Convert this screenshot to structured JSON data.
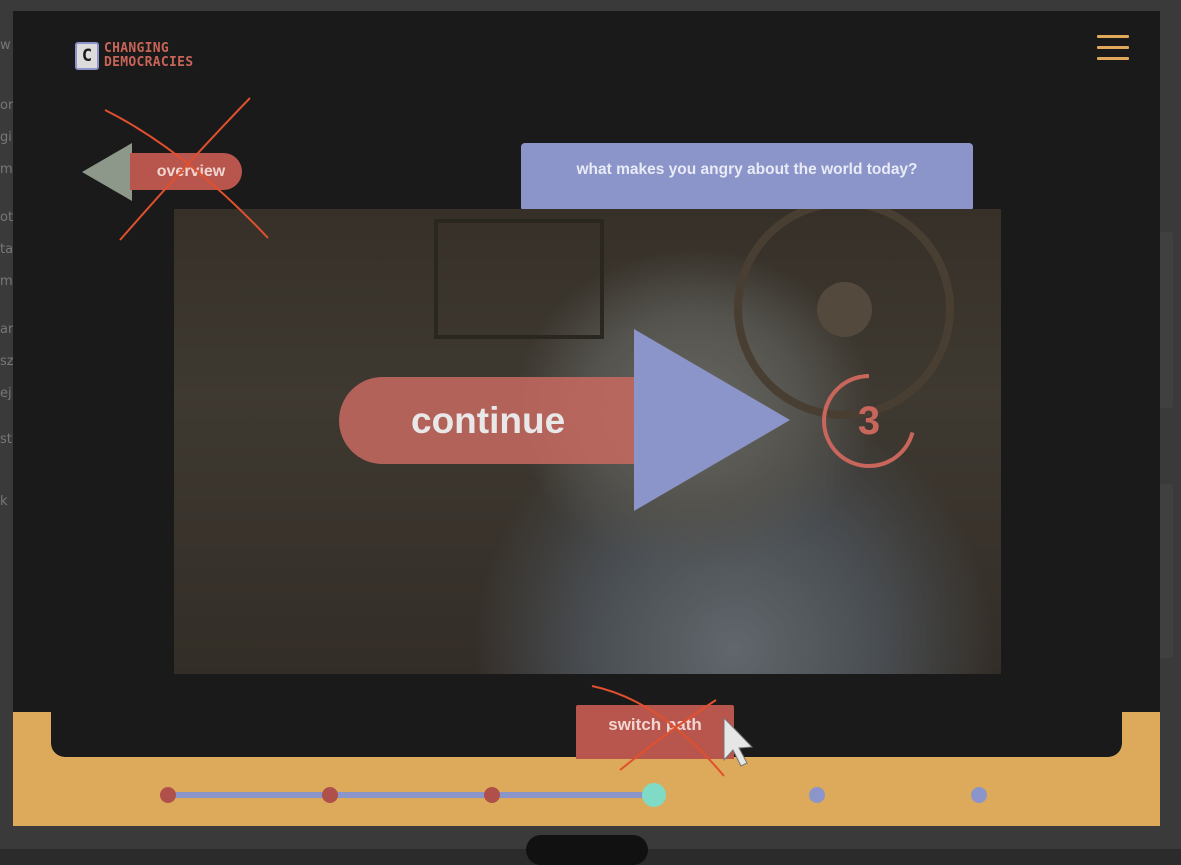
{
  "background": {
    "line_fragments": [
      "w",
      "or",
      "gi o",
      "m",
      "ot",
      "ta",
      "m",
      "ar",
      "sz",
      "ej",
      "st",
      "k"
    ]
  },
  "header": {
    "logo_letter": "C",
    "logo_line1": "CHANGING",
    "logo_line2": "DEMOCRACIES",
    "menu_icon": "hamburger-menu-icon"
  },
  "nav": {
    "overview_label": "overview"
  },
  "question": {
    "text": "what makes you angry about the world today?"
  },
  "video_overlay": {
    "continue_label": "continue",
    "countdown": "3",
    "play_icon": "play-icon"
  },
  "footer": {
    "switch_path_label": "switch path",
    "timeline": {
      "nodes": [
        "done",
        "done",
        "done",
        "current",
        "future",
        "future"
      ]
    }
  },
  "colors": {
    "accent_red": "#b8554c",
    "accent_blue": "#8b95c9",
    "accent_gold": "#dcaa5a",
    "accent_teal": "#7fdbc5",
    "annotation_cross": "#e0502e"
  }
}
